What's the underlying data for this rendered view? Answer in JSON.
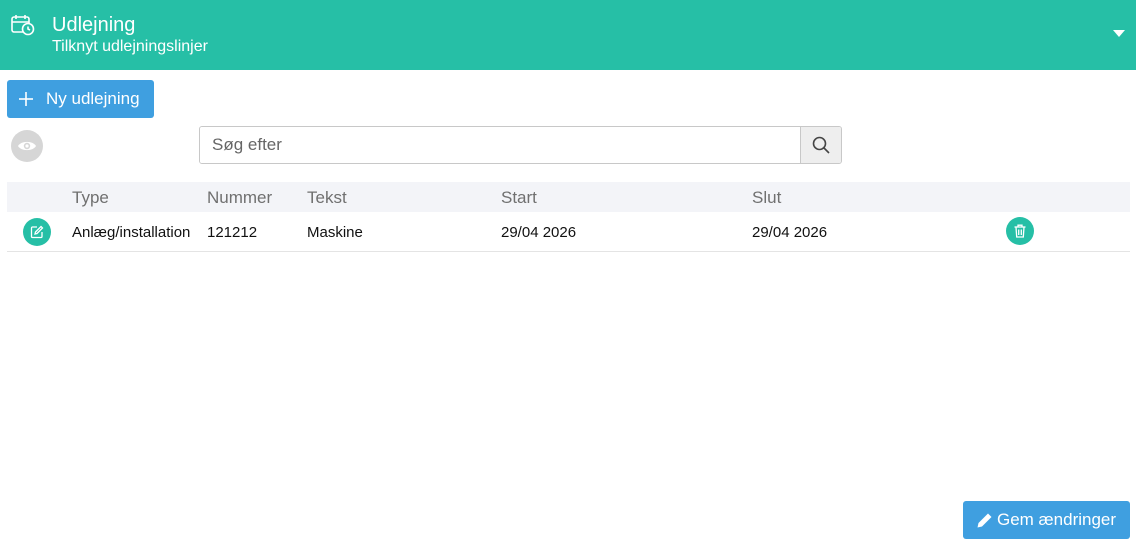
{
  "header": {
    "title": "Udlejning",
    "subtitle": "Tilknyt udlejningslinjer",
    "icon": "calendar-clock-icon",
    "background": "#26bfa6"
  },
  "toolbar": {
    "new_label": "Ny udlejning",
    "search_placeholder": "Søg efter",
    "search_value": ""
  },
  "table": {
    "columns": [
      "Type",
      "Nummer",
      "Tekst",
      "Start",
      "Slut"
    ],
    "rows": [
      {
        "type": "Anlæg/installation",
        "nummer": "121212",
        "tekst": "Maskine",
        "start": "29/04 2026",
        "slut": "29/04 2026"
      }
    ]
  },
  "footer": {
    "save_label": "Gem ændringer"
  },
  "colors": {
    "accent": "#26bfa6",
    "primary_button": "#3f9fe0",
    "table_header": "#f3f4f8"
  }
}
